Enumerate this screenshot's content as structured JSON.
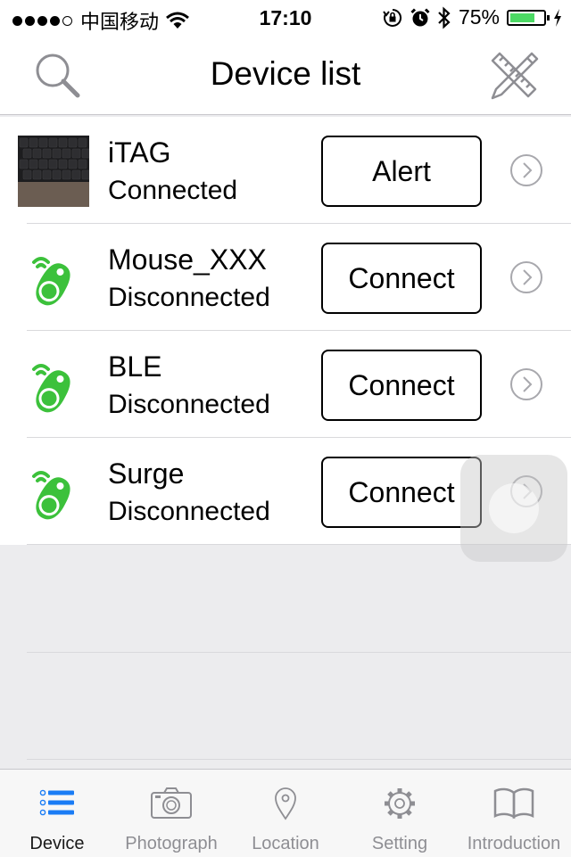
{
  "status_bar": {
    "carrier": "中国移动",
    "time": "17:10",
    "battery_percent": "75%",
    "battery_level": 0.75,
    "signal_bars": 4,
    "signal_total": 5
  },
  "nav": {
    "title": "Device list",
    "left_icon": "search-icon",
    "right_icon": "ruler-pencil-icon"
  },
  "devices": [
    {
      "name": "iTAG",
      "state": "Connected",
      "button": "Alert",
      "icon": "keyboard-photo"
    },
    {
      "name": "Mouse_XXX",
      "state": "Disconnected",
      "button": "Connect",
      "icon": "itag-green-icon"
    },
    {
      "name": "BLE",
      "state": "Disconnected",
      "button": "Connect",
      "icon": "itag-green-icon"
    },
    {
      "name": "Surge",
      "state": "Disconnected",
      "button": "Connect",
      "icon": "itag-green-icon"
    }
  ],
  "tabs": [
    {
      "label": "Device",
      "icon": "list-icon",
      "active": true
    },
    {
      "label": "Photograph",
      "icon": "camera-icon",
      "active": false
    },
    {
      "label": "Location",
      "icon": "location-pin-icon",
      "active": false
    },
    {
      "label": "Setting",
      "icon": "gear-icon",
      "active": false
    },
    {
      "label": "Introduction",
      "icon": "book-icon",
      "active": false
    }
  ],
  "colors": {
    "accent": "#1a7cf5",
    "device_icon_green": "#3cc13b",
    "battery_green": "#4cd964"
  }
}
